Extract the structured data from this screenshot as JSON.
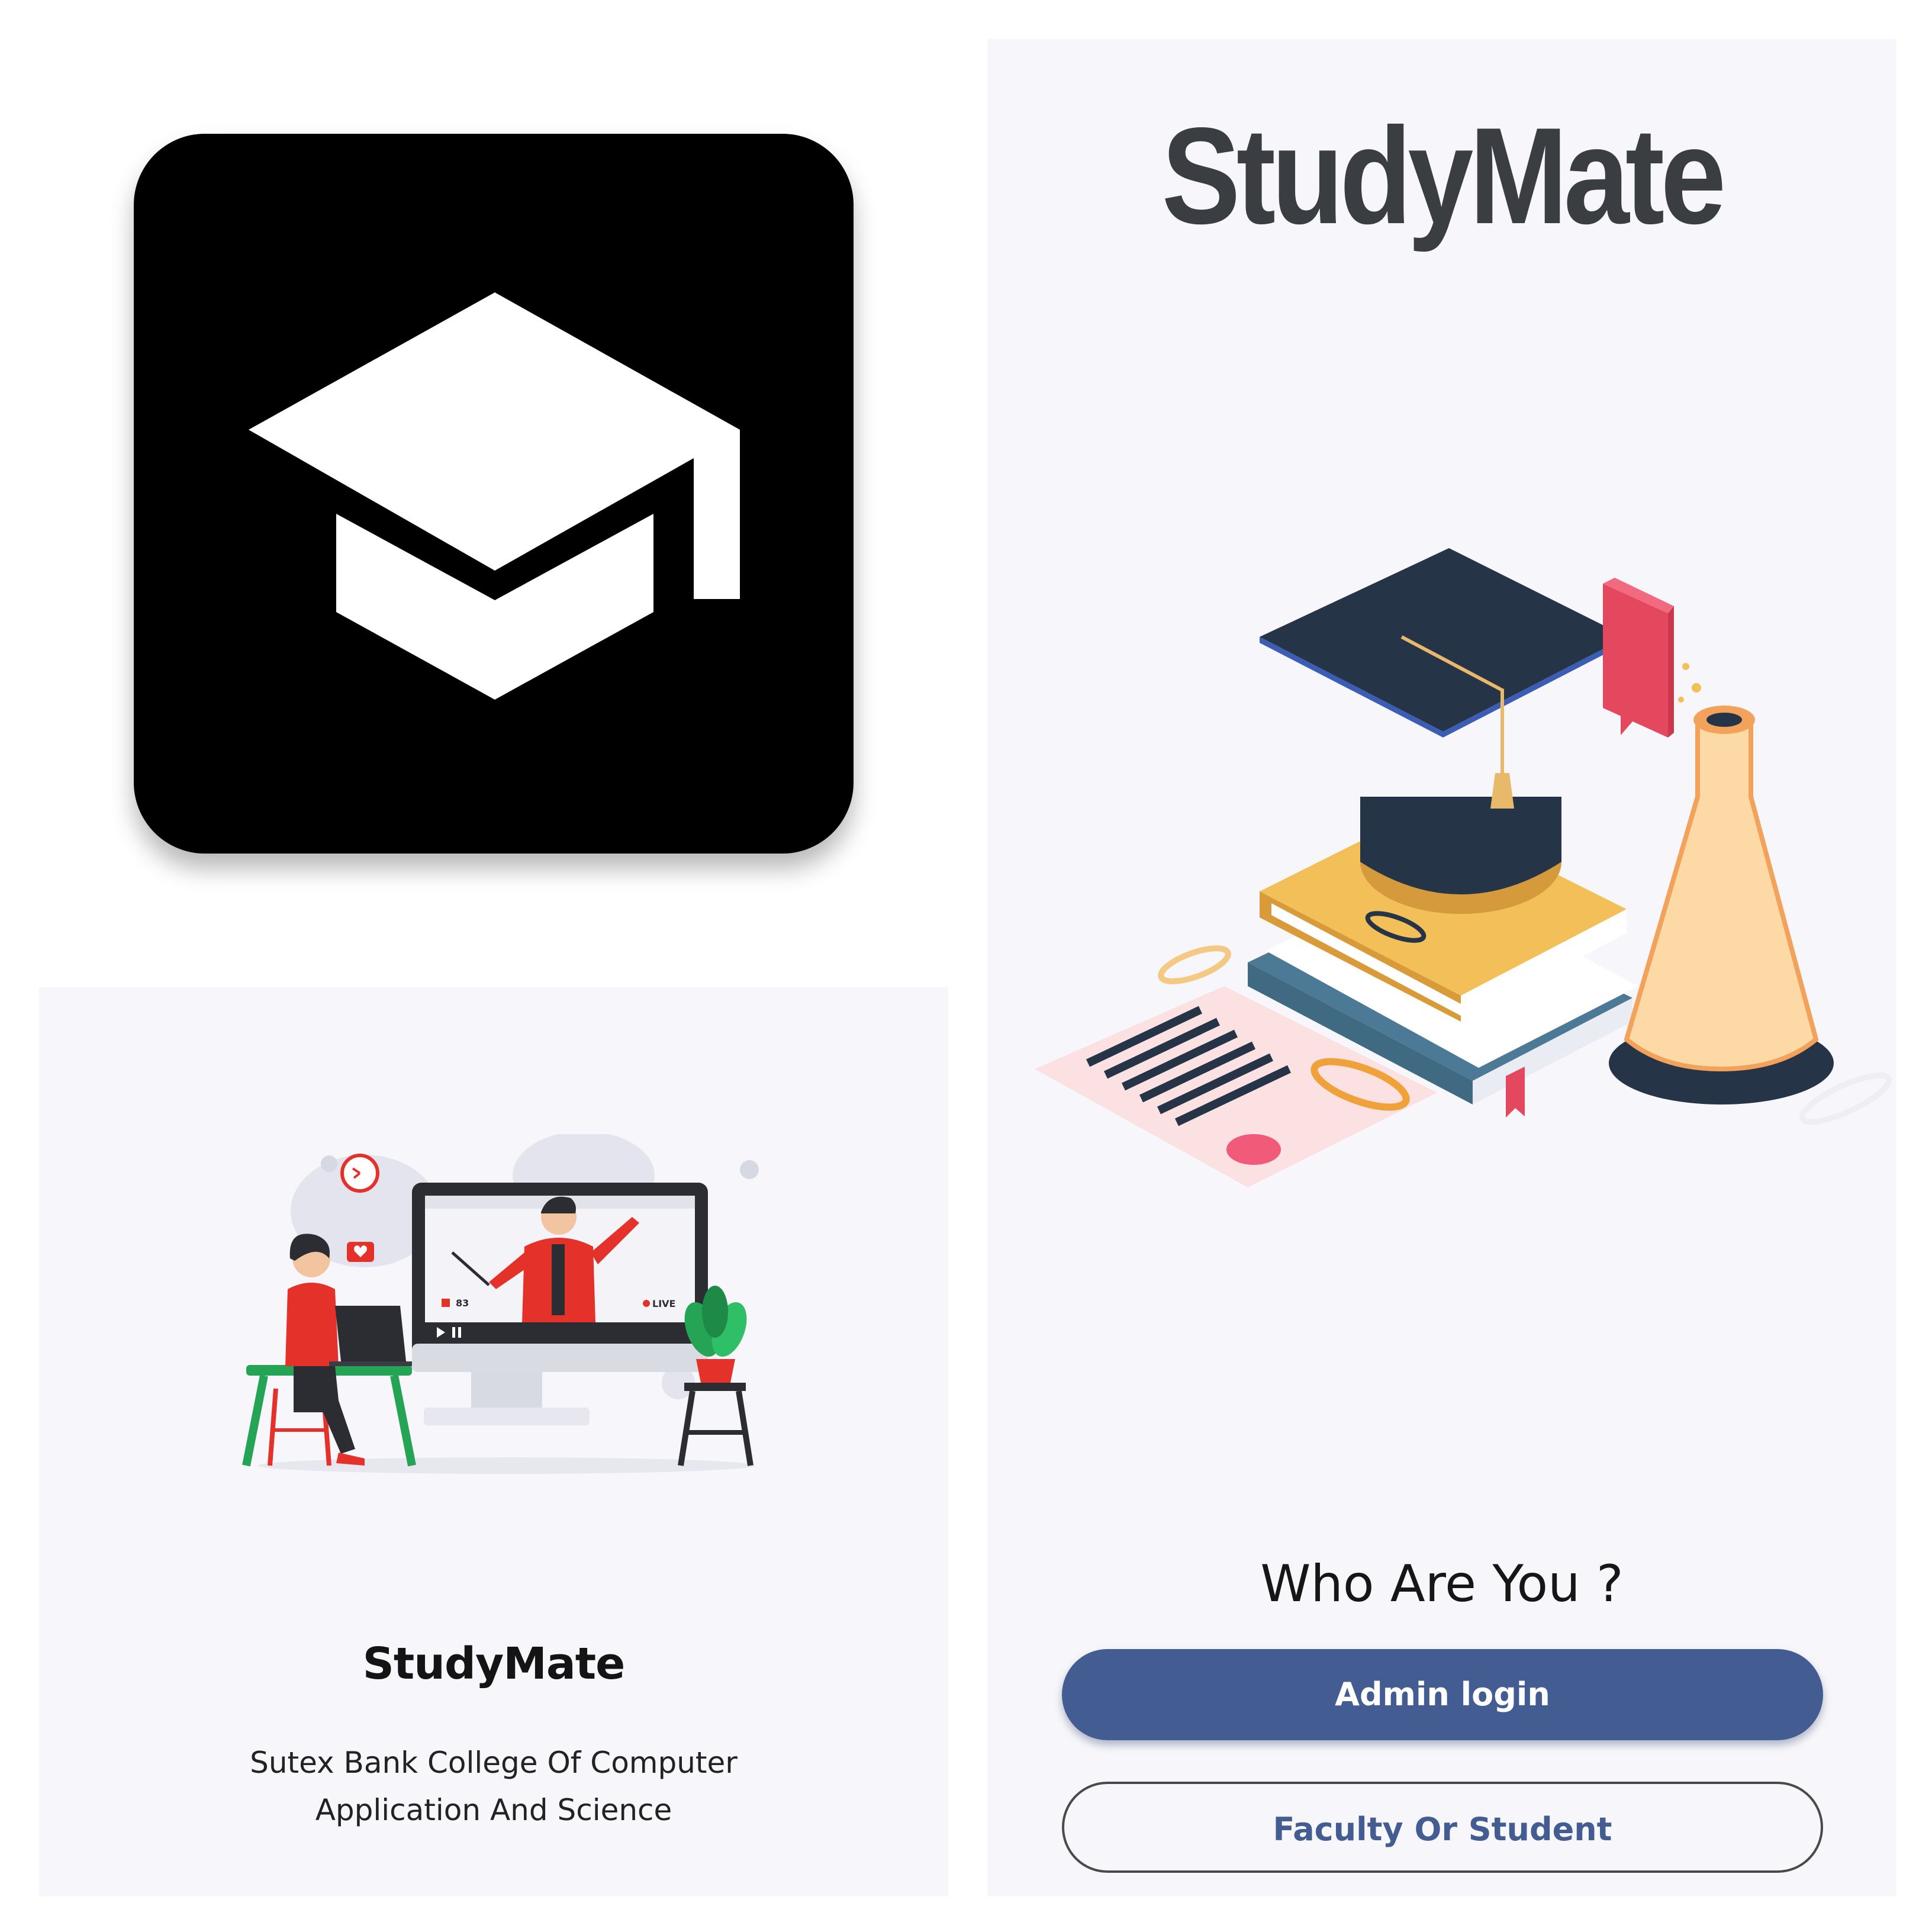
{
  "app_icon": {
    "icon": "graduation-cap-icon"
  },
  "splash": {
    "title": "StudyMate",
    "subtitle": "Sutex Bank College Of Computer Application And Science",
    "illustration": "online-class-illustration",
    "screen_labels": {
      "viewer_count": "83",
      "live_badge": "LIVE"
    }
  },
  "role_select": {
    "title": "StudyMate",
    "illustration": "education-illustration",
    "question": "Who Are You ?",
    "buttons": {
      "admin_label": "Admin login",
      "faculty_label": "Faculty Or Student"
    }
  },
  "colors": {
    "primary": "#435d93",
    "background": "#f7f7fb",
    "title_text": "#3a3d41",
    "icon_background": "#000000"
  }
}
